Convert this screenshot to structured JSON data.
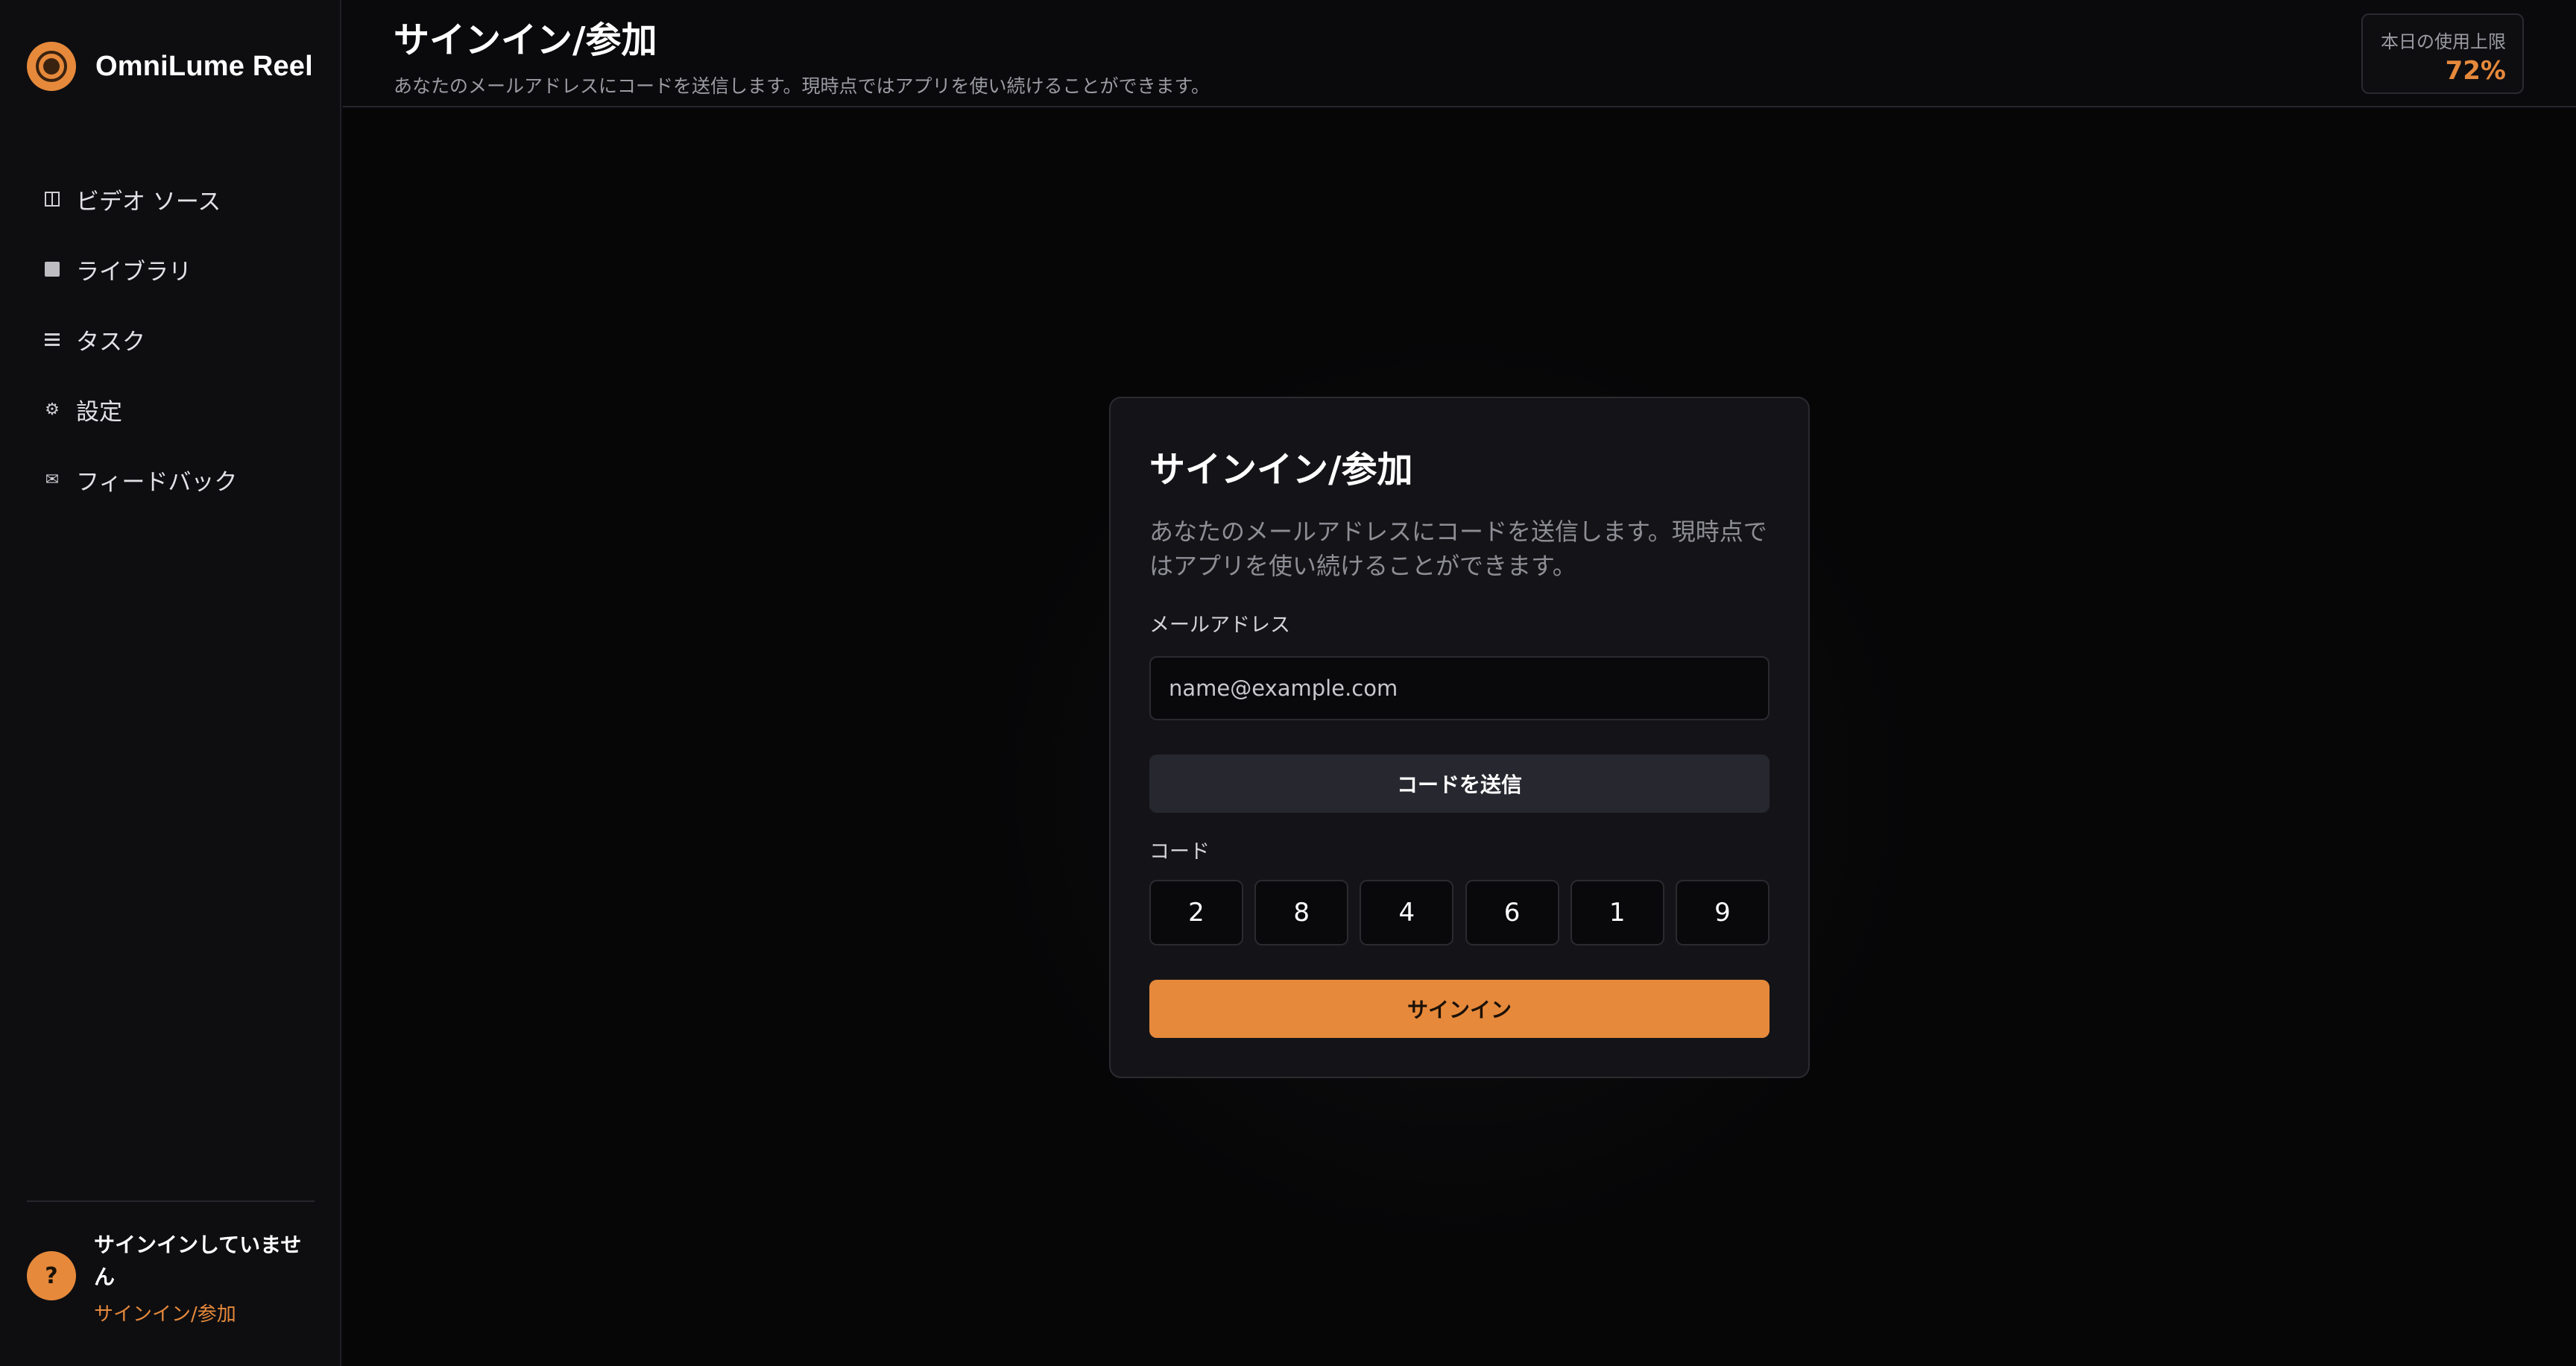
{
  "app": {
    "name": "OmniLume Reel"
  },
  "sidebar": {
    "items": [
      {
        "label": "ビデオ ソース",
        "icon": "split-view-icon"
      },
      {
        "label": "ライブラリ",
        "icon": "square-icon"
      },
      {
        "label": "タスク",
        "icon": "list-icon"
      },
      {
        "label": "設定",
        "icon": "gear-icon"
      },
      {
        "label": "フィードバック",
        "icon": "mail-icon"
      }
    ],
    "user": {
      "avatar_glyph": "?",
      "status": "サインインしていません",
      "link": "サインイン/参加"
    }
  },
  "header": {
    "title": "サインイン/参加",
    "subtitle": "あなたのメールアドレスにコードを送信します。現時点ではアプリを使い続けることができます。",
    "usage_label": "本日の使用上限",
    "usage_value": "72%"
  },
  "card": {
    "title": "サインイン/参加",
    "description": "あなたのメールアドレスにコードを送信します。現時点ではアプリを使い続けることができます。",
    "email_label": "メールアドレス",
    "email_placeholder": "name@example.com",
    "email_value": "",
    "send_button": "コードを送信",
    "code_label": "コード",
    "code_digits": [
      "2",
      "8",
      "4",
      "6",
      "1",
      "9"
    ],
    "signin_button": "サインイン"
  },
  "colors": {
    "accent": "#e6893b",
    "background": "#0a0a0c",
    "card": "#141418"
  }
}
